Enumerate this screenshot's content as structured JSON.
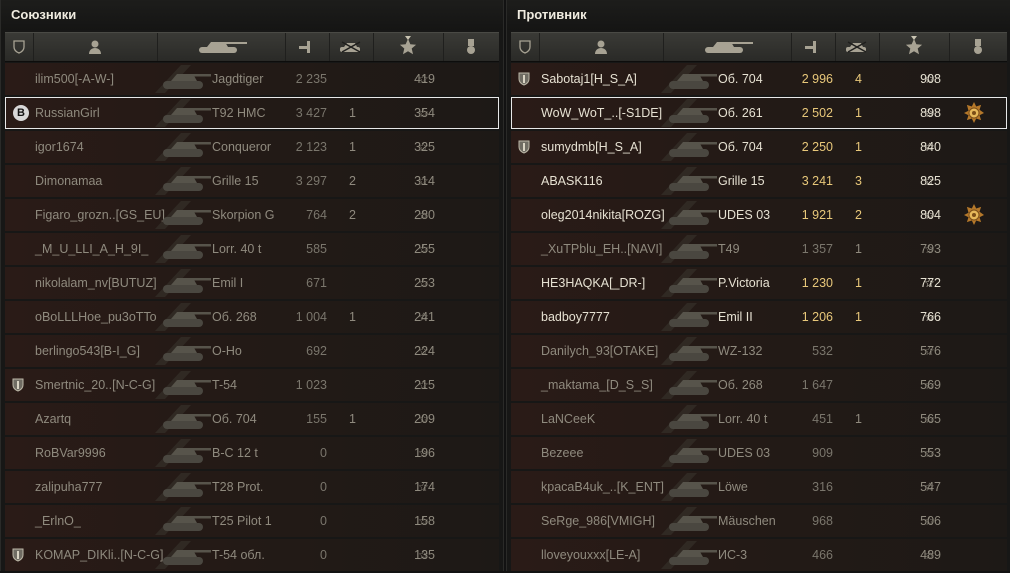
{
  "allies": {
    "title": "Союзники",
    "rows": [
      {
        "nick": "ilim500[-A-W-]",
        "vehicle": "Jagdtiger",
        "damage": "2 235",
        "kills": "",
        "xp": "419",
        "alive": false,
        "clan": false,
        "me": false
      },
      {
        "nick": "RussianGirl",
        "vehicle": "T92 HMC",
        "damage": "3 427",
        "kills": "1",
        "xp": "354",
        "alive": false,
        "clan": false,
        "me": true,
        "badge_letter": "B"
      },
      {
        "nick": "igor1674",
        "vehicle": "Conqueror",
        "damage": "2 123",
        "kills": "1",
        "xp": "325",
        "alive": false,
        "clan": false,
        "me": false
      },
      {
        "nick": "Dimonamaa",
        "vehicle": "Grille 15",
        "damage": "3 297",
        "kills": "2",
        "xp": "314",
        "alive": false,
        "clan": false,
        "me": false
      },
      {
        "nick": "Figaro_grozn..[GS_EU]",
        "vehicle": "Skorpion G",
        "damage": "764",
        "kills": "2",
        "xp": "280",
        "alive": false,
        "clan": false,
        "me": false
      },
      {
        "nick": "_M_U_LLI_A_H_9I_",
        "vehicle": "Lorr. 40 t",
        "damage": "585",
        "kills": "",
        "xp": "255",
        "alive": false,
        "clan": false,
        "me": false
      },
      {
        "nick": "nikolalam_nv[BUTUZ]",
        "vehicle": "Emil I",
        "damage": "671",
        "kills": "",
        "xp": "253",
        "alive": false,
        "clan": false,
        "me": false
      },
      {
        "nick": "oBoLLLHoe_pu3oTTo",
        "vehicle": "Об. 268",
        "damage": "1 004",
        "kills": "1",
        "xp": "241",
        "alive": false,
        "clan": false,
        "me": false
      },
      {
        "nick": "berlingo543[B-I_G]",
        "vehicle": "O-Ho",
        "damage": "692",
        "kills": "",
        "xp": "224",
        "alive": false,
        "clan": false,
        "me": false
      },
      {
        "nick": "Smertnic_20..[N-C-G]",
        "vehicle": "T-54",
        "damage": "1 023",
        "kills": "",
        "xp": "215",
        "alive": false,
        "clan": true,
        "me": false
      },
      {
        "nick": "Azartq",
        "vehicle": "Об. 704",
        "damage": "155",
        "kills": "1",
        "xp": "209",
        "alive": false,
        "clan": false,
        "me": false
      },
      {
        "nick": "RoBVar9996",
        "vehicle": "B-C 12 t",
        "damage": "0",
        "kills": "",
        "xp": "196",
        "alive": false,
        "clan": false,
        "me": false
      },
      {
        "nick": "zalipuha777",
        "vehicle": "T28 Prot.",
        "damage": "0",
        "kills": "",
        "xp": "174",
        "alive": false,
        "clan": false,
        "me": false
      },
      {
        "nick": "_ErlnO_",
        "vehicle": "T25 Pilot 1",
        "damage": "0",
        "kills": "",
        "xp": "158",
        "alive": false,
        "clan": false,
        "me": false
      },
      {
        "nick": "KOMAP_DIKli..[N-C-G]",
        "vehicle": "T-54 обл.",
        "damage": "0",
        "kills": "",
        "xp": "135",
        "alive": false,
        "clan": true,
        "me": false
      }
    ]
  },
  "enemies": {
    "title": "Противник",
    "rows": [
      {
        "nick": "Sabotaj1[H_S_A]",
        "vehicle": "Об. 704",
        "damage": "2 996",
        "kills": "4",
        "xp": "908",
        "alive": true,
        "clan": true,
        "me": false
      },
      {
        "nick": "WoW_WoT_..[-S1DE]",
        "vehicle": "Об. 261",
        "damage": "2 502",
        "kills": "1",
        "xp": "898",
        "alive": true,
        "clan": false,
        "me": true,
        "medal": true
      },
      {
        "nick": "sumydmb[H_S_A]",
        "vehicle": "Об. 704",
        "damage": "2 250",
        "kills": "1",
        "xp": "840",
        "alive": true,
        "clan": true,
        "me": false
      },
      {
        "nick": "ABASK116",
        "vehicle": "Grille 15",
        "damage": "3 241",
        "kills": "3",
        "xp": "825",
        "alive": true,
        "clan": false,
        "me": false
      },
      {
        "nick": "oleg2014nikita[ROZG]",
        "vehicle": "UDES 03",
        "damage": "1 921",
        "kills": "2",
        "xp": "804",
        "alive": true,
        "clan": false,
        "me": false,
        "medal": true
      },
      {
        "nick": "_XuTPblu_EH..[NAVI]",
        "vehicle": "T49",
        "damage": "1 357",
        "kills": "1",
        "xp": "793",
        "alive": false,
        "clan": false,
        "me": false
      },
      {
        "nick": "HE3HAQKA[_DR-]",
        "vehicle": "P.Victoria",
        "damage": "1 230",
        "kills": "1",
        "xp": "772",
        "alive": true,
        "clan": false,
        "me": false
      },
      {
        "nick": "badboy7777",
        "vehicle": "Emil II",
        "damage": "1 206",
        "kills": "1",
        "xp": "766",
        "alive": true,
        "clan": false,
        "me": false
      },
      {
        "nick": "Danilych_93[OTAKE]",
        "vehicle": "WZ-132",
        "damage": "532",
        "kills": "",
        "xp": "576",
        "alive": false,
        "clan": false,
        "me": false
      },
      {
        "nick": "_maktama_[D_S_S]",
        "vehicle": "Об. 268",
        "damage": "1 647",
        "kills": "",
        "xp": "569",
        "alive": false,
        "clan": false,
        "me": false
      },
      {
        "nick": "LaNCeeK",
        "vehicle": "Lorr. 40 t",
        "damage": "451",
        "kills": "1",
        "xp": "565",
        "alive": false,
        "clan": false,
        "me": false
      },
      {
        "nick": "Bezeee",
        "vehicle": "UDES 03",
        "damage": "909",
        "kills": "",
        "xp": "553",
        "alive": false,
        "clan": false,
        "me": false
      },
      {
        "nick": "kpacaB4uk_..[K_ENT]",
        "vehicle": "Löwe",
        "damage": "316",
        "kills": "",
        "xp": "547",
        "alive": false,
        "clan": false,
        "me": false
      },
      {
        "nick": "SeRge_986[VMIGH]",
        "vehicle": "Mäuschen",
        "damage": "968",
        "kills": "",
        "xp": "506",
        "alive": false,
        "clan": false,
        "me": false
      },
      {
        "nick": "lloveyouxxx[LE-A]",
        "vehicle": "ИС-3",
        "damage": "466",
        "kills": "",
        "xp": "489",
        "alive": false,
        "clan": false,
        "me": false
      }
    ]
  },
  "icons": {
    "clan": "shield-icon",
    "player": "player-icon",
    "tank": "tank-icon",
    "damage": "damage-icon",
    "kills": "destroyed-icon",
    "xp": "star-icon",
    "medal": "medal-icon",
    "star_glyph": "☆"
  },
  "colors": {
    "alive_text": "#e6e1d2",
    "dead_text": "#8f8a7e",
    "damage_alive": "#e8c87a",
    "highlight": "#e8e8e8"
  }
}
